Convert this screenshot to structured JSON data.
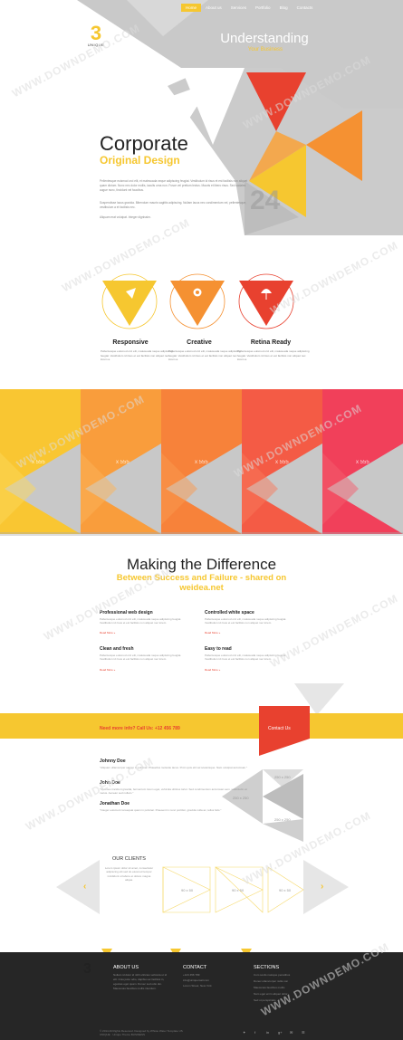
{
  "nav": {
    "items": [
      "Home",
      "About us",
      "Services",
      "Portfolio",
      "Blog",
      "Contacts"
    ]
  },
  "logo": {
    "number": "3",
    "word": "UNIQUE"
  },
  "hero": {
    "title": "Understanding",
    "subtitle": "Your Business",
    "heading": "Corporate",
    "heading_sub": "Original Design",
    "para1": "Pellentesque euismod orci elit, et malesuada neque adipiscing feugiat. Vestibulum id risus et est facilisis non aliquet quam dictum. Nunc nec dolor mollis, iaculis urna non. Fusce vel pretium lectus. Mauris et libero risus. Sed sodales augue nunc, tincidunt vel faucibus.",
    "para2": "Suspendisse lacus gravida. Bibendum mauris sagittis adipiscing. Nullam lacus nec condimentum vel, pellentesque, vestibulum a et facilisis nec.",
    "para3": "Aliquam erat volutpat. Integer dignissim.",
    "bignum": "24"
  },
  "features": [
    {
      "title": "Responsive",
      "text": "Pellentesque euismod orci elit, malesuada neque adipiscing feugiat. Vestibulum id risus et est facilisis non aliquet nec lorem a.",
      "icon": "rocket-icon"
    },
    {
      "title": "Creative",
      "text": "Pellentesque euismod orci elit, malesuada neque adipiscing feugiat. Vestibulum id risus et est facilisis non aliquet nec lorem a.",
      "icon": "globe-icon"
    },
    {
      "title": "Retina Ready",
      "text": "Pellentesque euismod orci elit, malesuada neque adipiscing feugiat. Vestibulum id risus et est facilisis non aliquet nec lorem a.",
      "icon": "umbrella-icon"
    }
  ],
  "portfolio": {
    "badges": [
      "x 555",
      "x 555",
      "x 555",
      "x 555",
      "x 555"
    ],
    "colors": [
      "#f9c632",
      "#f99d3c",
      "#f7823a",
      "#f45b45",
      "#f1405a"
    ]
  },
  "making": {
    "title": "Making the Difference",
    "subtitle": "Between Success and Failure - shared on weidea.net",
    "services": [
      {
        "title": "Professional web design",
        "text": "Pellentesque euismod orci elit, malesuada neque adipiscing feugiat. Vestibulum id risus et est facilisis non aliquet nec lorem.",
        "more": "Read More »"
      },
      {
        "title": "Controlled white space",
        "text": "Pellentesque euismod orci elit, malesuada neque adipiscing feugiat. Vestibulum id risus et est facilisis non aliquet nec lorem.",
        "more": "Read More »"
      },
      {
        "title": "Clean and fresh",
        "text": "Pellentesque euismod orci elit, malesuada neque adipiscing feugiat. Vestibulum id risus et est facilisis non aliquet nec lorem.",
        "more": "Read More »"
      },
      {
        "title": "Easy to read",
        "text": "Pellentesque euismod orci elit, malesuada neque adipiscing feugiat. Vestibulum id risus et est facilisis non aliquet nec lorem.",
        "more": "Read More »"
      }
    ]
  },
  "cta": {
    "text": "Need more info? Call Us: +12 456 789",
    "button": "Contact Us"
  },
  "testimonials": [
    {
      "name": "Johnny Doe",
      "text": "\"Aliquam ullamcorper sapien in pulvinar. Phasellus molestie lacus. Proin quis elit vel scelerisque. Nam volutpat accumsan.\""
    },
    {
      "name": "John Doe",
      "text": "\"Vivamus tincidunt gravida, fermentum lorem eget, vehicula ultrices tortor. Sed condimentum accumsan sem, sollicitudin at metus. Aenean sed nullam.\""
    },
    {
      "name": "Jonathan Doe",
      "text": "\"Integer euismod consequat quam in pulvinar. Praesent in nunc porttitor, gravida nulla ac, tellus felis.\""
    }
  ],
  "placeholders": [
    "250 x 250",
    "250 x 250",
    "250 x 250"
  ],
  "clients": {
    "title": "OUR CLIENTS",
    "text": "Lorem ipsum dolor sit amet, consectetur adipiscing elit sed do eiusmod tempor incididunt ut labore et dolore magna aliqua.",
    "logos": [
      "90 x 50",
      "90 x 50",
      "90 x 50"
    ],
    "prev": "‹",
    "next": "›"
  },
  "footer": {
    "logo": "3",
    "about_title": "ABOUT US",
    "about_text": "Nullam id dolor id nibh ultricies vehicula ut id elit. Cras justo odio, dapibus ac facilisis in, egestas eget quam. Donec sed odio dui. Maecenas faucibus mollis interdum.",
    "contact_title": "CONTACT",
    "contact_lines": [
      "+123 456 789",
      "info@uniquemail.com",
      "Lorem Street, New York"
    ],
    "sections_title": "SECTIONS",
    "sections": [
      "Cum sociis natoque penatibus",
      "Donec ullamcorper nulla non",
      "Maecenas faucibus mollis",
      "Nam eget enim aliquet dolor",
      "Sed ut perspiciatis"
    ],
    "copyright": "© 2014 All Rights Reserved. Designed by Whiste Water Template US\nUNIQUE · Unique Theme BUSINESS",
    "social": [
      "✦",
      "f",
      "in",
      "g+",
      "✉",
      "☰"
    ]
  },
  "watermark": "WWW.DOWNDEMO.COM"
}
